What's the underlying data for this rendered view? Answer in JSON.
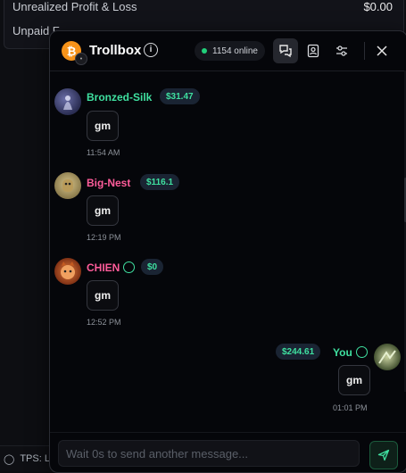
{
  "background": {
    "row1_label": "Unrealized Profit & Loss",
    "row1_value": "$0.00",
    "row2_label": "Unpaid F..."
  },
  "footer": {
    "tps_label": "TPS: L"
  },
  "trollbox": {
    "title": "Trollbox",
    "online_text": "1154 online",
    "colors": {
      "online": "#21d07a",
      "amount": "#3fe0a0",
      "bronzed": "#3fe0a0",
      "bignest": "#ff5c9a",
      "chien": "#ff5c9a"
    }
  },
  "messages": [
    {
      "username": "Bronzed-Silk",
      "amount": "$31.47",
      "text": "gm",
      "time": "11:54 AM"
    },
    {
      "username": "Big-Nest",
      "amount": "$116.1",
      "text": "gm",
      "time": "12:19 PM"
    },
    {
      "username": "CHIEN",
      "amount": "$0",
      "text": "gm",
      "time": "12:52 PM"
    },
    {
      "username": "You",
      "amount": "$244.61",
      "text": "gm",
      "time": "01:01 PM"
    }
  ],
  "input": {
    "placeholder": "Wait 0s to send another message..."
  }
}
